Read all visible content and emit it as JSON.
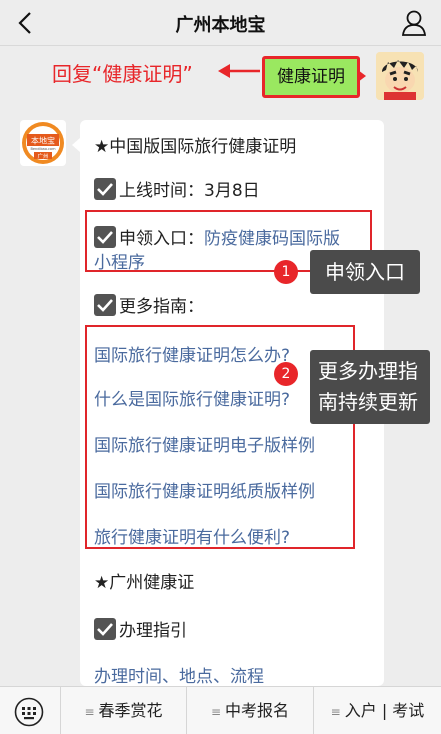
{
  "header": {
    "title": "广州本地宝",
    "back_icon": "chevron-left-icon",
    "profile_icon": "person-icon"
  },
  "reply_hint": "回复“健康证明”",
  "user_message": "健康证明",
  "bot_avatar": {
    "brand": "本地宝",
    "subtitle": "Bendibao.com",
    "city": "广州"
  },
  "message": {
    "section1_title": "★中国版国际旅行健康证明",
    "online_time": "上线时间：3月8日",
    "apply_label": "申领入口：",
    "apply_link_1": "防疫健康码国际版",
    "apply_link_2": "小程序",
    "more_guides": "更多指南：",
    "guides": [
      "国际旅行健康证明怎么办?",
      "什么是国际旅行健康证明?",
      "国际旅行健康证明电子版样例",
      "国际旅行健康证明纸质版样例",
      "旅行健康证明有什么便利?"
    ],
    "section2_title": "★广州健康证",
    "process_guide": "办理指引",
    "process_link": "办理时间、地点、流程"
  },
  "callouts": {
    "badge1": "1",
    "text1": "申领入口",
    "badge2": "2",
    "text2_line1": "更多办理指",
    "text2_line2": "南持续更新"
  },
  "bottom_menu": {
    "keyboard_icon": "keyboard-icon",
    "items": [
      "春季赏花",
      "中考报名",
      "入户 | 考试"
    ]
  },
  "colors": {
    "accent_red": "#e8262a",
    "bubble_green": "#9ae860",
    "link_blue": "#4a6a9e",
    "callout_gray": "#4b4b4b"
  }
}
